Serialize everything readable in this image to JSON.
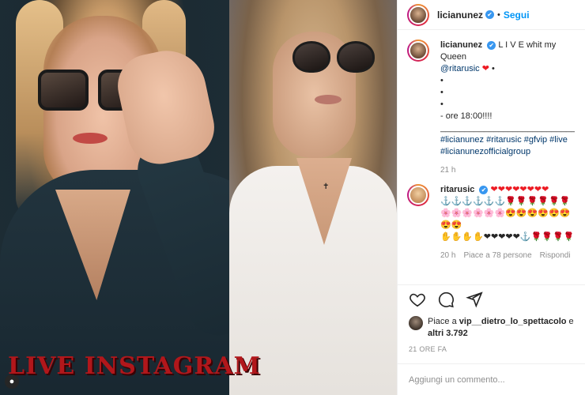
{
  "media": {
    "overlay_text": "LIVE INSTAGRAM"
  },
  "header": {
    "username": "licianunez",
    "verified_badge": "✔",
    "separator": "•",
    "follow_label": "Segui"
  },
  "caption": {
    "username": "licianunez",
    "text_line1": "L I V E whit my Queen",
    "mention": "@ritarusic",
    "heart": "❤",
    "bullet": "•",
    "line_bullet": "•",
    "time_line": "- ore 18:00!!!!",
    "divider": "_______________________________",
    "tags_line1": "#licianunez #ritarusic #gfvip #live",
    "tags_line2": "#licianunezofficialgroup",
    "age": "21 h"
  },
  "comment": {
    "username": "ritarusic",
    "line1": "❤❤❤❤❤❤❤❤",
    "line2": "⚓⚓⚓⚓⚓⚓🌹🌹🌹🌹🌹🌹",
    "line3": "🌸🌸🌸🌸🌸🌸😍😍😍😍😍😍😍😍",
    "line4": "✋✋✋✋❤❤❤❤❤⚓🌹🌹🌹🌹",
    "age": "20 h",
    "likes": "Piace a 78 persone",
    "reply": "Rispondi"
  },
  "likes": {
    "prefix": "Piace a",
    "user": "vip__dietro_lo_spettacolo",
    "suffix": "e",
    "others": "altri 3.792"
  },
  "timestamp": "21 ORE FA",
  "add_comment_placeholder": "Aggiungi un commento...",
  "icons": [
    "heart-icon",
    "comment-icon",
    "share-icon"
  ],
  "colors": {
    "link_blue": "#0095f6",
    "verified_blue": "#3897f0",
    "overlay_red": "#b1171b"
  }
}
